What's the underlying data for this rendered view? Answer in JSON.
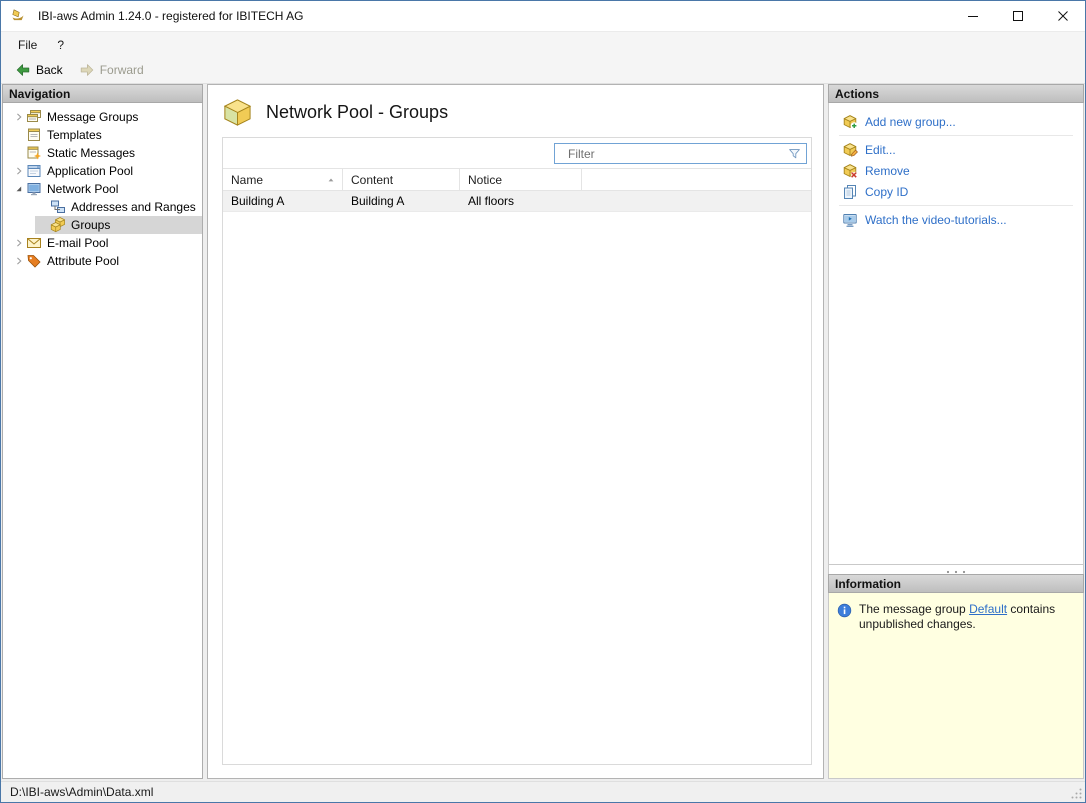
{
  "window": {
    "title": "IBI-aws Admin 1.24.0 - registered for IBITECH AG"
  },
  "menu": {
    "file": "File",
    "help": "?"
  },
  "toolbar": {
    "back": "Back",
    "forward": "Forward",
    "forward_enabled": false
  },
  "navigation": {
    "header": "Navigation",
    "items": [
      {
        "label": "Message Groups",
        "level": 0,
        "chevron": "collapsed",
        "icon": "message-groups",
        "selected": false
      },
      {
        "label": "Templates",
        "level": 0,
        "chevron": "none",
        "icon": "templates",
        "selected": false
      },
      {
        "label": "Static Messages",
        "level": 0,
        "chevron": "none",
        "icon": "static-messages",
        "selected": false
      },
      {
        "label": "Application Pool",
        "level": 0,
        "chevron": "collapsed",
        "icon": "application-pool",
        "selected": false
      },
      {
        "label": "Network Pool",
        "level": 0,
        "chevron": "expanded",
        "icon": "network-pool",
        "selected": false
      },
      {
        "label": "Addresses and Ranges",
        "level": 1,
        "chevron": "none",
        "icon": "addresses-and-ranges",
        "selected": false
      },
      {
        "label": "Groups",
        "level": 1,
        "chevron": "none",
        "icon": "groups",
        "selected": true
      },
      {
        "label": "E-mail Pool",
        "level": 0,
        "chevron": "collapsed",
        "icon": "email-pool",
        "selected": false
      },
      {
        "label": "Attribute Pool",
        "level": 0,
        "chevron": "collapsed",
        "icon": "attribute-pool",
        "selected": false
      }
    ]
  },
  "main": {
    "title": "Network Pool - Groups",
    "filter_placeholder": "Filter",
    "table": {
      "columns": [
        "Name",
        "Content",
        "Notice"
      ],
      "sort": {
        "column": "Name",
        "direction": "ascending"
      },
      "rows": [
        [
          "Building A",
          "Building A",
          "All floors"
        ]
      ]
    }
  },
  "actions": {
    "header": "Actions",
    "groups": [
      {
        "items": [
          {
            "label": "Add new group...",
            "icon": "add-group"
          }
        ]
      },
      {
        "items": [
          {
            "label": "Edit...",
            "icon": "edit-group"
          },
          {
            "label": "Remove",
            "icon": "remove-group"
          },
          {
            "label": "Copy ID",
            "icon": "copy-id"
          }
        ]
      },
      {
        "items": [
          {
            "label": "Watch the video-tutorials...",
            "icon": "video-tutorials"
          }
        ]
      }
    ]
  },
  "information": {
    "header": "Information",
    "text_before": "The message group ",
    "link_text": "Default",
    "text_after": " contains unpublished changes."
  },
  "statusbar": {
    "path": "D:\\IBI-aws\\Admin\\Data.xml"
  },
  "colors": {
    "link_blue": "#2E6FC8",
    "info_background": "#FFFFE1",
    "selection_gray": "#D6D6D6",
    "back_arrow_green": "#3E9B41"
  }
}
